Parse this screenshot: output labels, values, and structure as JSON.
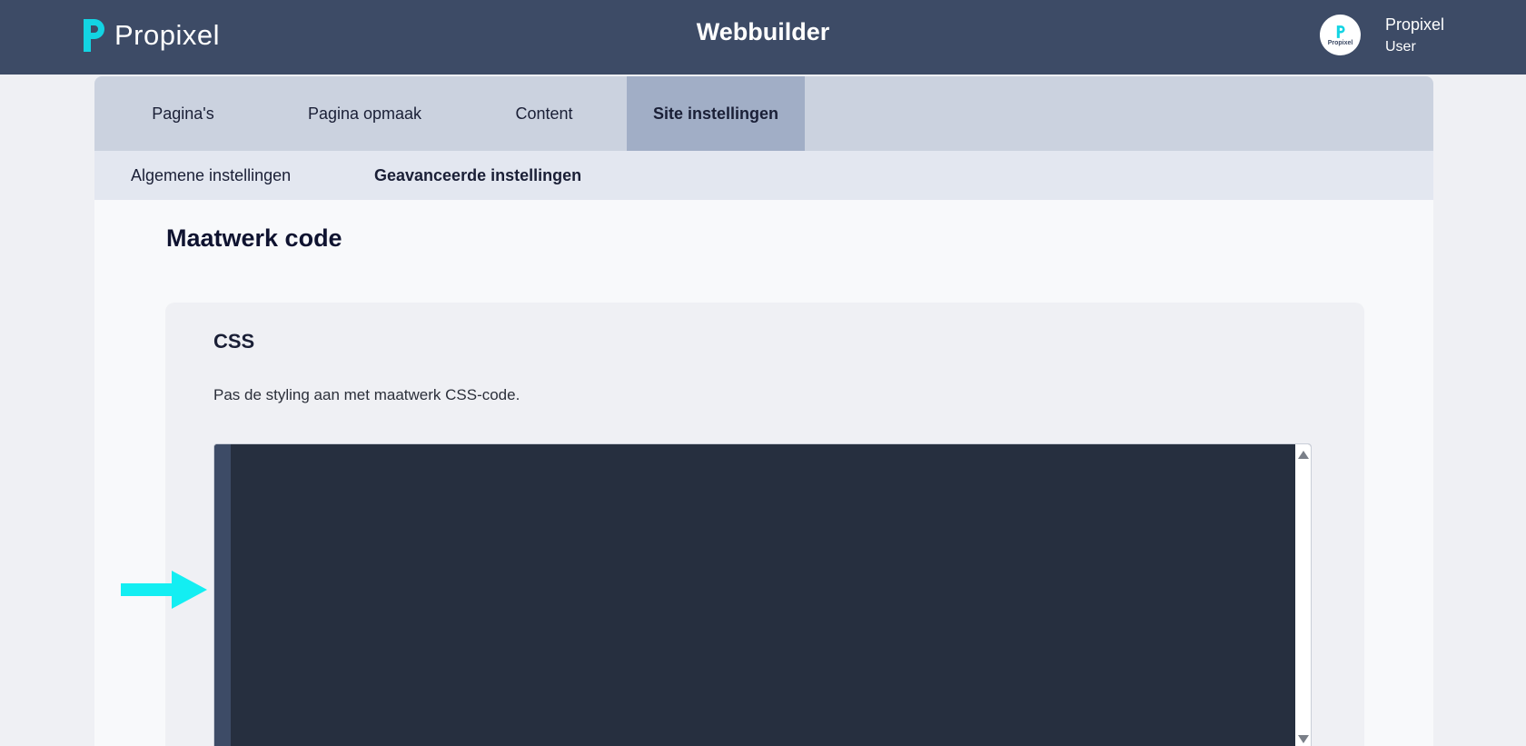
{
  "header": {
    "brand": "Propixel",
    "app_title": "Webbuilder",
    "avatar_text": "Propixel",
    "user_name": "Propixel",
    "user_role": "User",
    "colors": {
      "bar": "#3d4b66",
      "logo_accent": "#13d4e3"
    }
  },
  "tabs": [
    {
      "label": "Pagina's",
      "active": false
    },
    {
      "label": "Pagina opmaak",
      "active": false
    },
    {
      "label": "Content",
      "active": false
    },
    {
      "label": "Site instellingen",
      "active": true
    }
  ],
  "subtabs": [
    {
      "label": "Algemene instellingen",
      "active": false
    },
    {
      "label": "Geavanceerde instellingen",
      "active": true
    }
  ],
  "main": {
    "title": "Maatwerk code",
    "section": {
      "title": "CSS",
      "description": "Pas de styling aan met maatwerk CSS-code.",
      "editor_value": ""
    }
  },
  "annotation": {
    "icon": "arrow-right-icon",
    "color": "#13eef2"
  }
}
